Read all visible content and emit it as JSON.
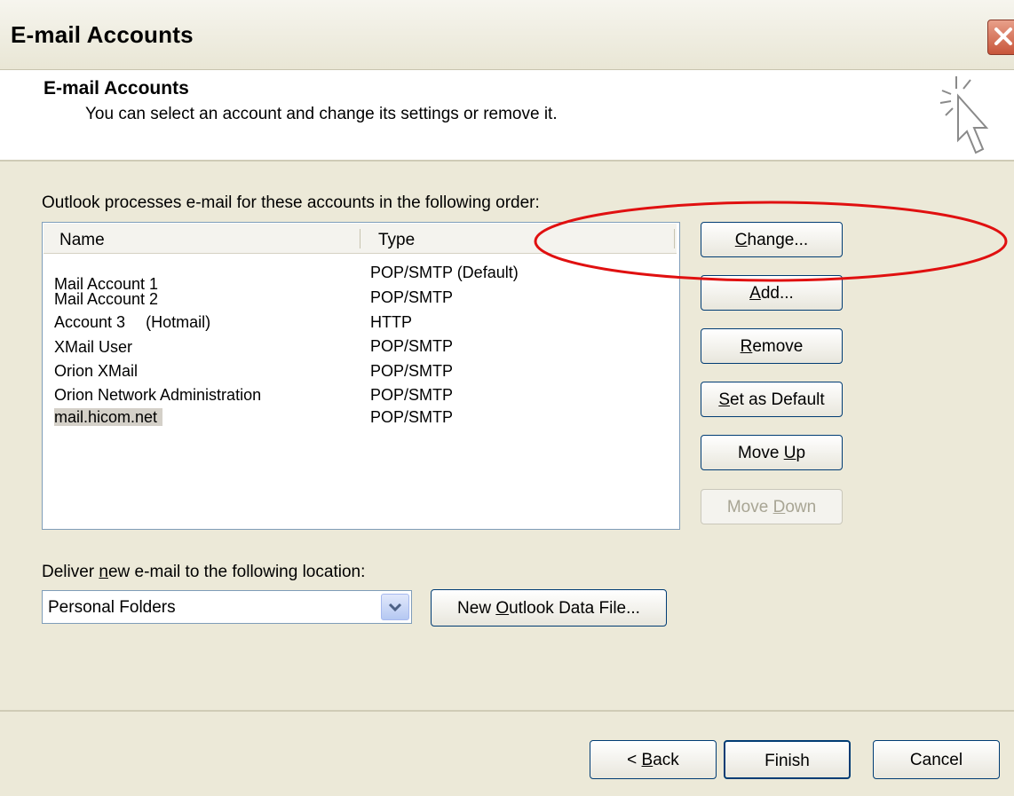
{
  "window": {
    "title": "E-mail Accounts"
  },
  "header": {
    "title": "E-mail Accounts",
    "subtitle": "You can select an account and change its settings or remove it."
  },
  "accounts": {
    "instruction": "Outlook processes e-mail for these accounts in the following order:",
    "columns": [
      "Name",
      "Type"
    ],
    "rows": [
      {
        "name": "Mail Account 1",
        "type": "POP/SMTP (Default)"
      },
      {
        "name": "Mail Account 2",
        "type": "POP/SMTP"
      },
      {
        "name": "Account 3",
        "note": "(Hotmail)",
        "type": "HTTP"
      },
      {
        "name": "XMail User",
        "type": "POP/SMTP"
      },
      {
        "name": "Orion XMail",
        "type": "POP/SMTP"
      },
      {
        "name": "Orion Network Administration",
        "type": "POP/SMTP"
      },
      {
        "name": "mail.hicom.net",
        "type": "POP/SMTP"
      }
    ],
    "selected_index": 6
  },
  "side_buttons": {
    "change": {
      "pre": "",
      "key": "C",
      "post": "hange..."
    },
    "add": {
      "pre": "",
      "key": "A",
      "post": "dd..."
    },
    "remove": {
      "pre": "",
      "key": "R",
      "post": "emove"
    },
    "set_default": {
      "pre": "",
      "key": "S",
      "post": "et as Default"
    },
    "move_up": {
      "pre": "Move ",
      "key": "U",
      "post": "p"
    },
    "move_down": {
      "pre": "Move ",
      "key": "D",
      "post": "own",
      "enabled": false
    }
  },
  "delivery": {
    "label_pre": "Deliver ",
    "label_key": "n",
    "label_post": "ew e-mail to the following location:",
    "location": "Personal Folders",
    "new_file": {
      "pre": "New ",
      "key": "O",
      "post": "utlook Data File..."
    }
  },
  "footer": {
    "back": {
      "pre": "< ",
      "key": "B",
      "post": "ack"
    },
    "finish": "Finish",
    "cancel": "Cancel"
  },
  "colors": {
    "annotation": "#e01010",
    "selection": "#d4d0c8",
    "button_border": "#003c74"
  }
}
